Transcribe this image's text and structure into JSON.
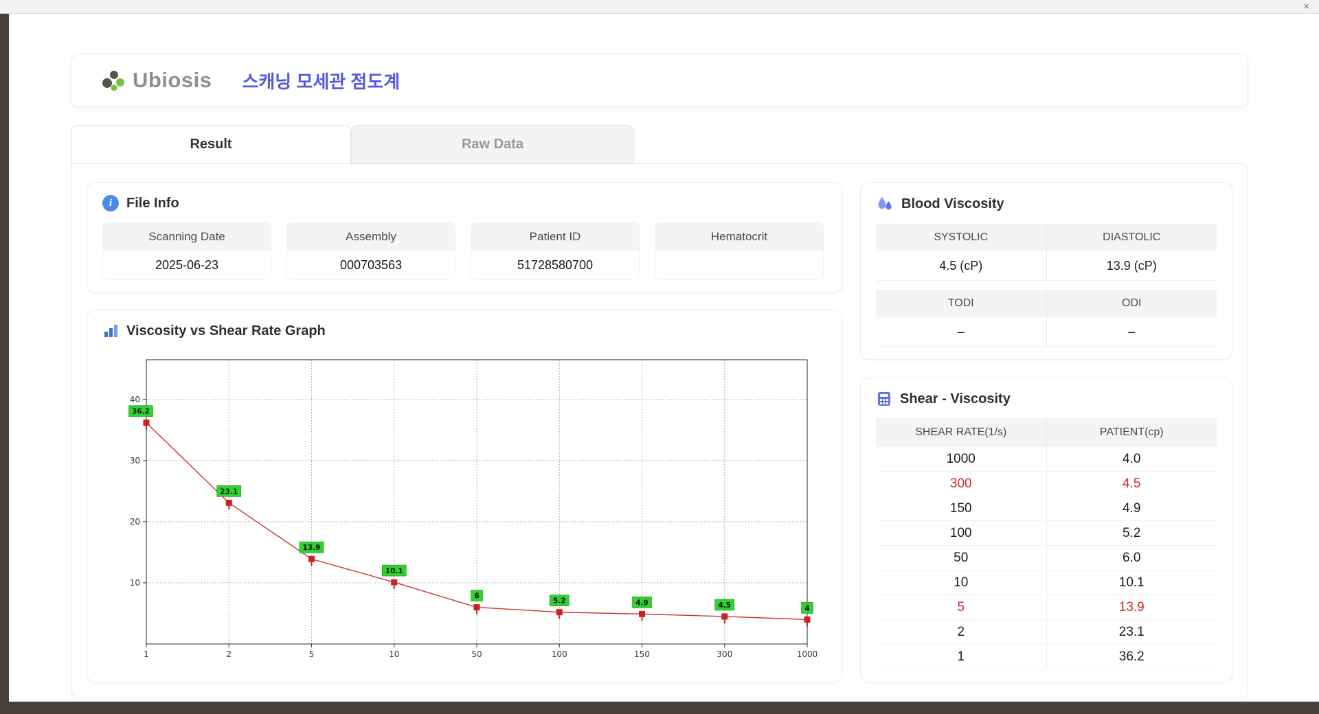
{
  "window": {
    "close_label": "×"
  },
  "header": {
    "logo_text": "Ubiosis",
    "title": "스캐닝 모세관 점도계"
  },
  "tabs": [
    {
      "label": "Result",
      "active": true
    },
    {
      "label": "Raw Data",
      "active": false
    }
  ],
  "file_info": {
    "title": "File Info",
    "fields": [
      {
        "label": "Scanning Date",
        "value": "2025-06-23"
      },
      {
        "label": "Assembly",
        "value": "000703563"
      },
      {
        "label": "Patient ID",
        "value": "51728580700"
      },
      {
        "label": "Hematocrit",
        "value": ""
      }
    ]
  },
  "blood_viscosity": {
    "title": "Blood Viscosity",
    "row1": {
      "h1": "SYSTOLIC",
      "h2": "DIASTOLIC",
      "v1": "4.5 (cP)",
      "v2": "13.9 (cP)"
    },
    "row2": {
      "h1": "TODI",
      "h2": "ODI",
      "v1": "–",
      "v2": "–"
    }
  },
  "shear_viscosity": {
    "title": "Shear - Viscosity",
    "columns": [
      "SHEAR RATE(1/s)",
      "PATIENT(cp)"
    ],
    "rows": [
      {
        "shear": "1000",
        "patient": "4.0",
        "highlight": false
      },
      {
        "shear": "300",
        "patient": "4.5",
        "highlight": true
      },
      {
        "shear": "150",
        "patient": "4.9",
        "highlight": false
      },
      {
        "shear": "100",
        "patient": "5.2",
        "highlight": false
      },
      {
        "shear": "50",
        "patient": "6.0",
        "highlight": false
      },
      {
        "shear": "10",
        "patient": "10.1",
        "highlight": false
      },
      {
        "shear": "5",
        "patient": "13.9",
        "highlight": true
      },
      {
        "shear": "2",
        "patient": "23.1",
        "highlight": false
      },
      {
        "shear": "1",
        "patient": "36.2",
        "highlight": false
      }
    ]
  },
  "chart_data": {
    "type": "line",
    "title": "Viscosity vs Shear Rate Graph",
    "xlabel": "",
    "ylabel": "",
    "x_scale": "categorical",
    "x": [
      1,
      2,
      5,
      10,
      50,
      100,
      150,
      300,
      1000
    ],
    "x_tick_labels": [
      "1",
      "2",
      "5",
      "10",
      "50",
      "100",
      "150",
      "300",
      "1000"
    ],
    "values": [
      36.2,
      23.1,
      13.9,
      10.1,
      6.0,
      5.2,
      4.9,
      4.5,
      4.0
    ],
    "point_labels": [
      "36.2",
      "23.1",
      "13.9",
      "10.1",
      "6",
      "5.2",
      "4.9",
      "4.5",
      "4"
    ],
    "y_ticks": [
      10,
      20,
      30,
      40
    ],
    "ylim": [
      0,
      46.5
    ],
    "grid": "dotted",
    "legend": "none",
    "line_color": "#cc3333",
    "marker_color": "#cc2222",
    "point_label_bg": "#2fd330",
    "point_label_border": "#1c8a1c"
  },
  "icons": {
    "info_glyph": "i"
  },
  "colors": {
    "accent_blue": "#5558e0",
    "icon_blue": "#4a8ae8",
    "highlight_red": "#cc2a2a",
    "marker_green": "#2fd330"
  }
}
